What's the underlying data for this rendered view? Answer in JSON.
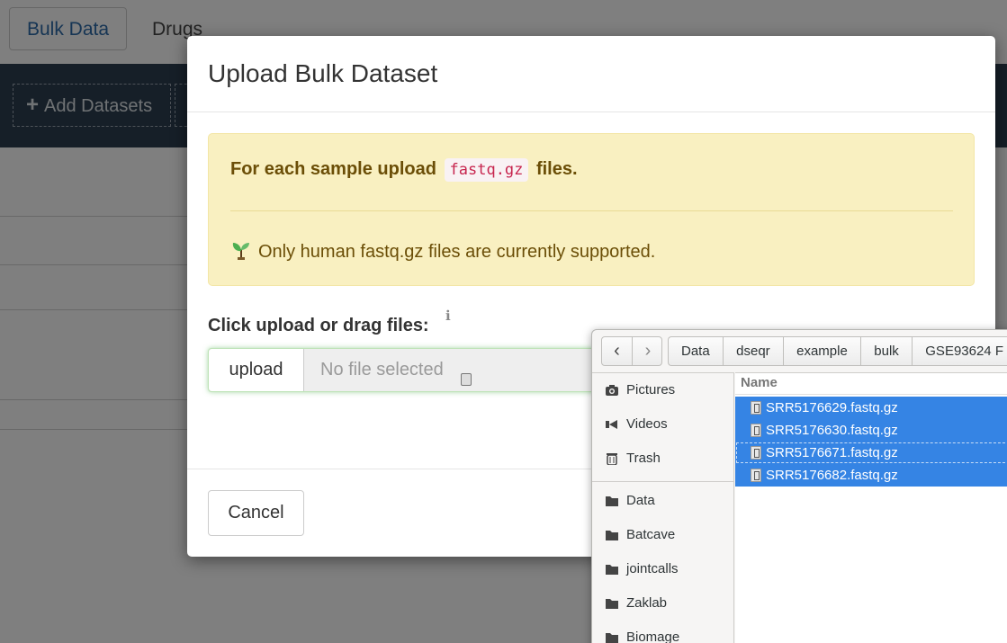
{
  "background": {
    "tabs": [
      {
        "label": "Bulk Data"
      },
      {
        "label": "Drugs"
      }
    ],
    "toolbar": {
      "add_label": "Add Datasets",
      "add_icon": "plus-icon"
    }
  },
  "modal": {
    "title": "Upload Bulk Dataset",
    "alert": {
      "prefix": "For each sample upload",
      "code": "fastq.gz",
      "suffix": "files.",
      "note_icon": "seedling-icon",
      "note": "Only human fastq.gz files are currently supported."
    },
    "upload": {
      "label": "Click upload or drag files:",
      "info_icon": "info-icon",
      "button": "upload",
      "status": "No file selected"
    },
    "cancel": "Cancel"
  },
  "file_chooser": {
    "breadcrumbs": [
      "Data",
      "dseqr",
      "example",
      "bulk",
      "GSE93624 F"
    ],
    "places": [
      {
        "label": "Pictures",
        "icon": "camera-icon"
      },
      {
        "label": "Videos",
        "icon": "video-icon"
      },
      {
        "label": "Trash",
        "icon": "trash-icon"
      },
      {
        "label": "Data",
        "icon": "folder-icon"
      },
      {
        "label": "Batcave",
        "icon": "folder-icon"
      },
      {
        "label": "jointcalls",
        "icon": "folder-icon"
      },
      {
        "label": "Zaklab",
        "icon": "folder-icon"
      },
      {
        "label": "Biomage",
        "icon": "folder-icon"
      }
    ],
    "column_header": "Name",
    "files": [
      {
        "name": "SRR5176629.fastq.gz",
        "selected": true
      },
      {
        "name": "SRR5176630.fastq.gz",
        "selected": true
      },
      {
        "name": "SRR5176671.fastq.gz",
        "selected": true
      },
      {
        "name": "SRR5176682.fastq.gz",
        "selected": true
      }
    ]
  }
}
